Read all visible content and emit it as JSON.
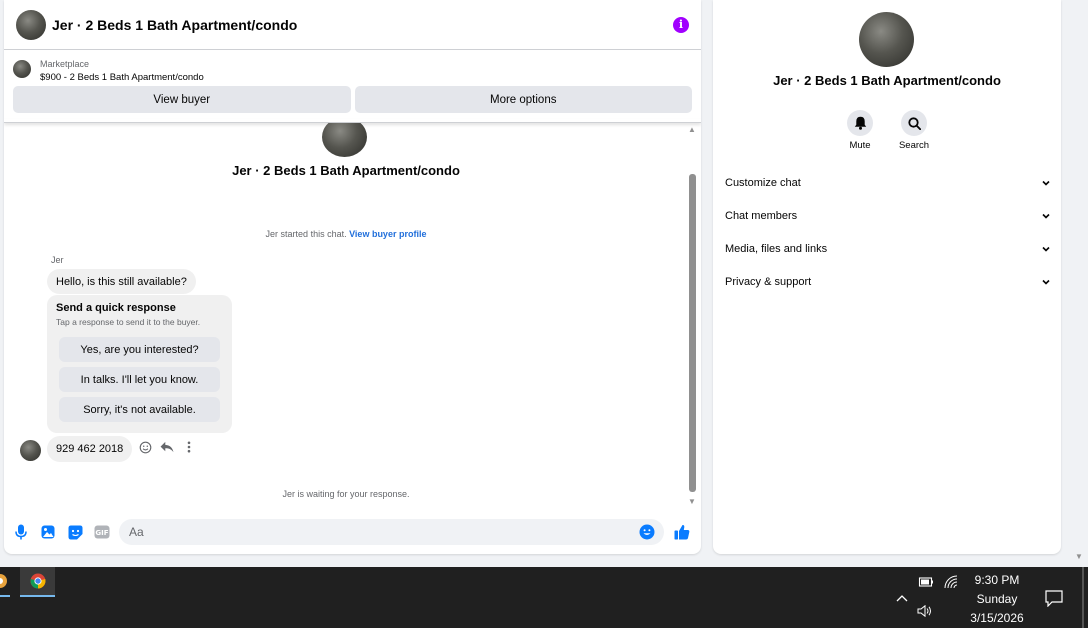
{
  "chat": {
    "title": "Jer · 2 Beds 1 Bath Apartment/condo",
    "info_icon": "info-icon",
    "listing": {
      "type": "Marketplace",
      "description": "$900 - 2 Beds 1 Bath Apartment/condo"
    },
    "actions": {
      "view_buyer": "View buyer",
      "more_options": "More options"
    }
  },
  "thread": {
    "title": "Jer · 2 Beds 1 Bath Apartment/condo",
    "started_text": "Jer started this chat. ",
    "started_link": "View buyer profile",
    "sender_name": "Jer",
    "message1": "Hello, is this still available?",
    "quick_response": {
      "title": "Send a quick response",
      "subtitle": "Tap a response to send it to the buyer.",
      "options": [
        "Yes, are you interested?",
        "In talks. I'll let you know.",
        "Sorry, it's not available."
      ]
    },
    "message2": "929 462 2018",
    "waiting_text": "Jer is waiting for your response."
  },
  "composer": {
    "placeholder": "Aa",
    "value": ""
  },
  "info_panel": {
    "title": "Jer · 2 Beds 1 Bath Apartment/condo",
    "actions": [
      {
        "label": "Mute",
        "icon": "bell-icon"
      },
      {
        "label": "Search",
        "icon": "search-icon"
      }
    ],
    "sections": [
      "Customize chat",
      "Chat members",
      "Media, files and links",
      "Privacy & support"
    ]
  },
  "taskbar": {
    "time": "9:30 PM",
    "day": "Sunday",
    "date": "3/15/2026"
  },
  "colors": {
    "accent_blue": "#0a7cff",
    "link_blue": "#216fdb",
    "info_purple": "#a100ff",
    "taskbar": "#202020"
  }
}
